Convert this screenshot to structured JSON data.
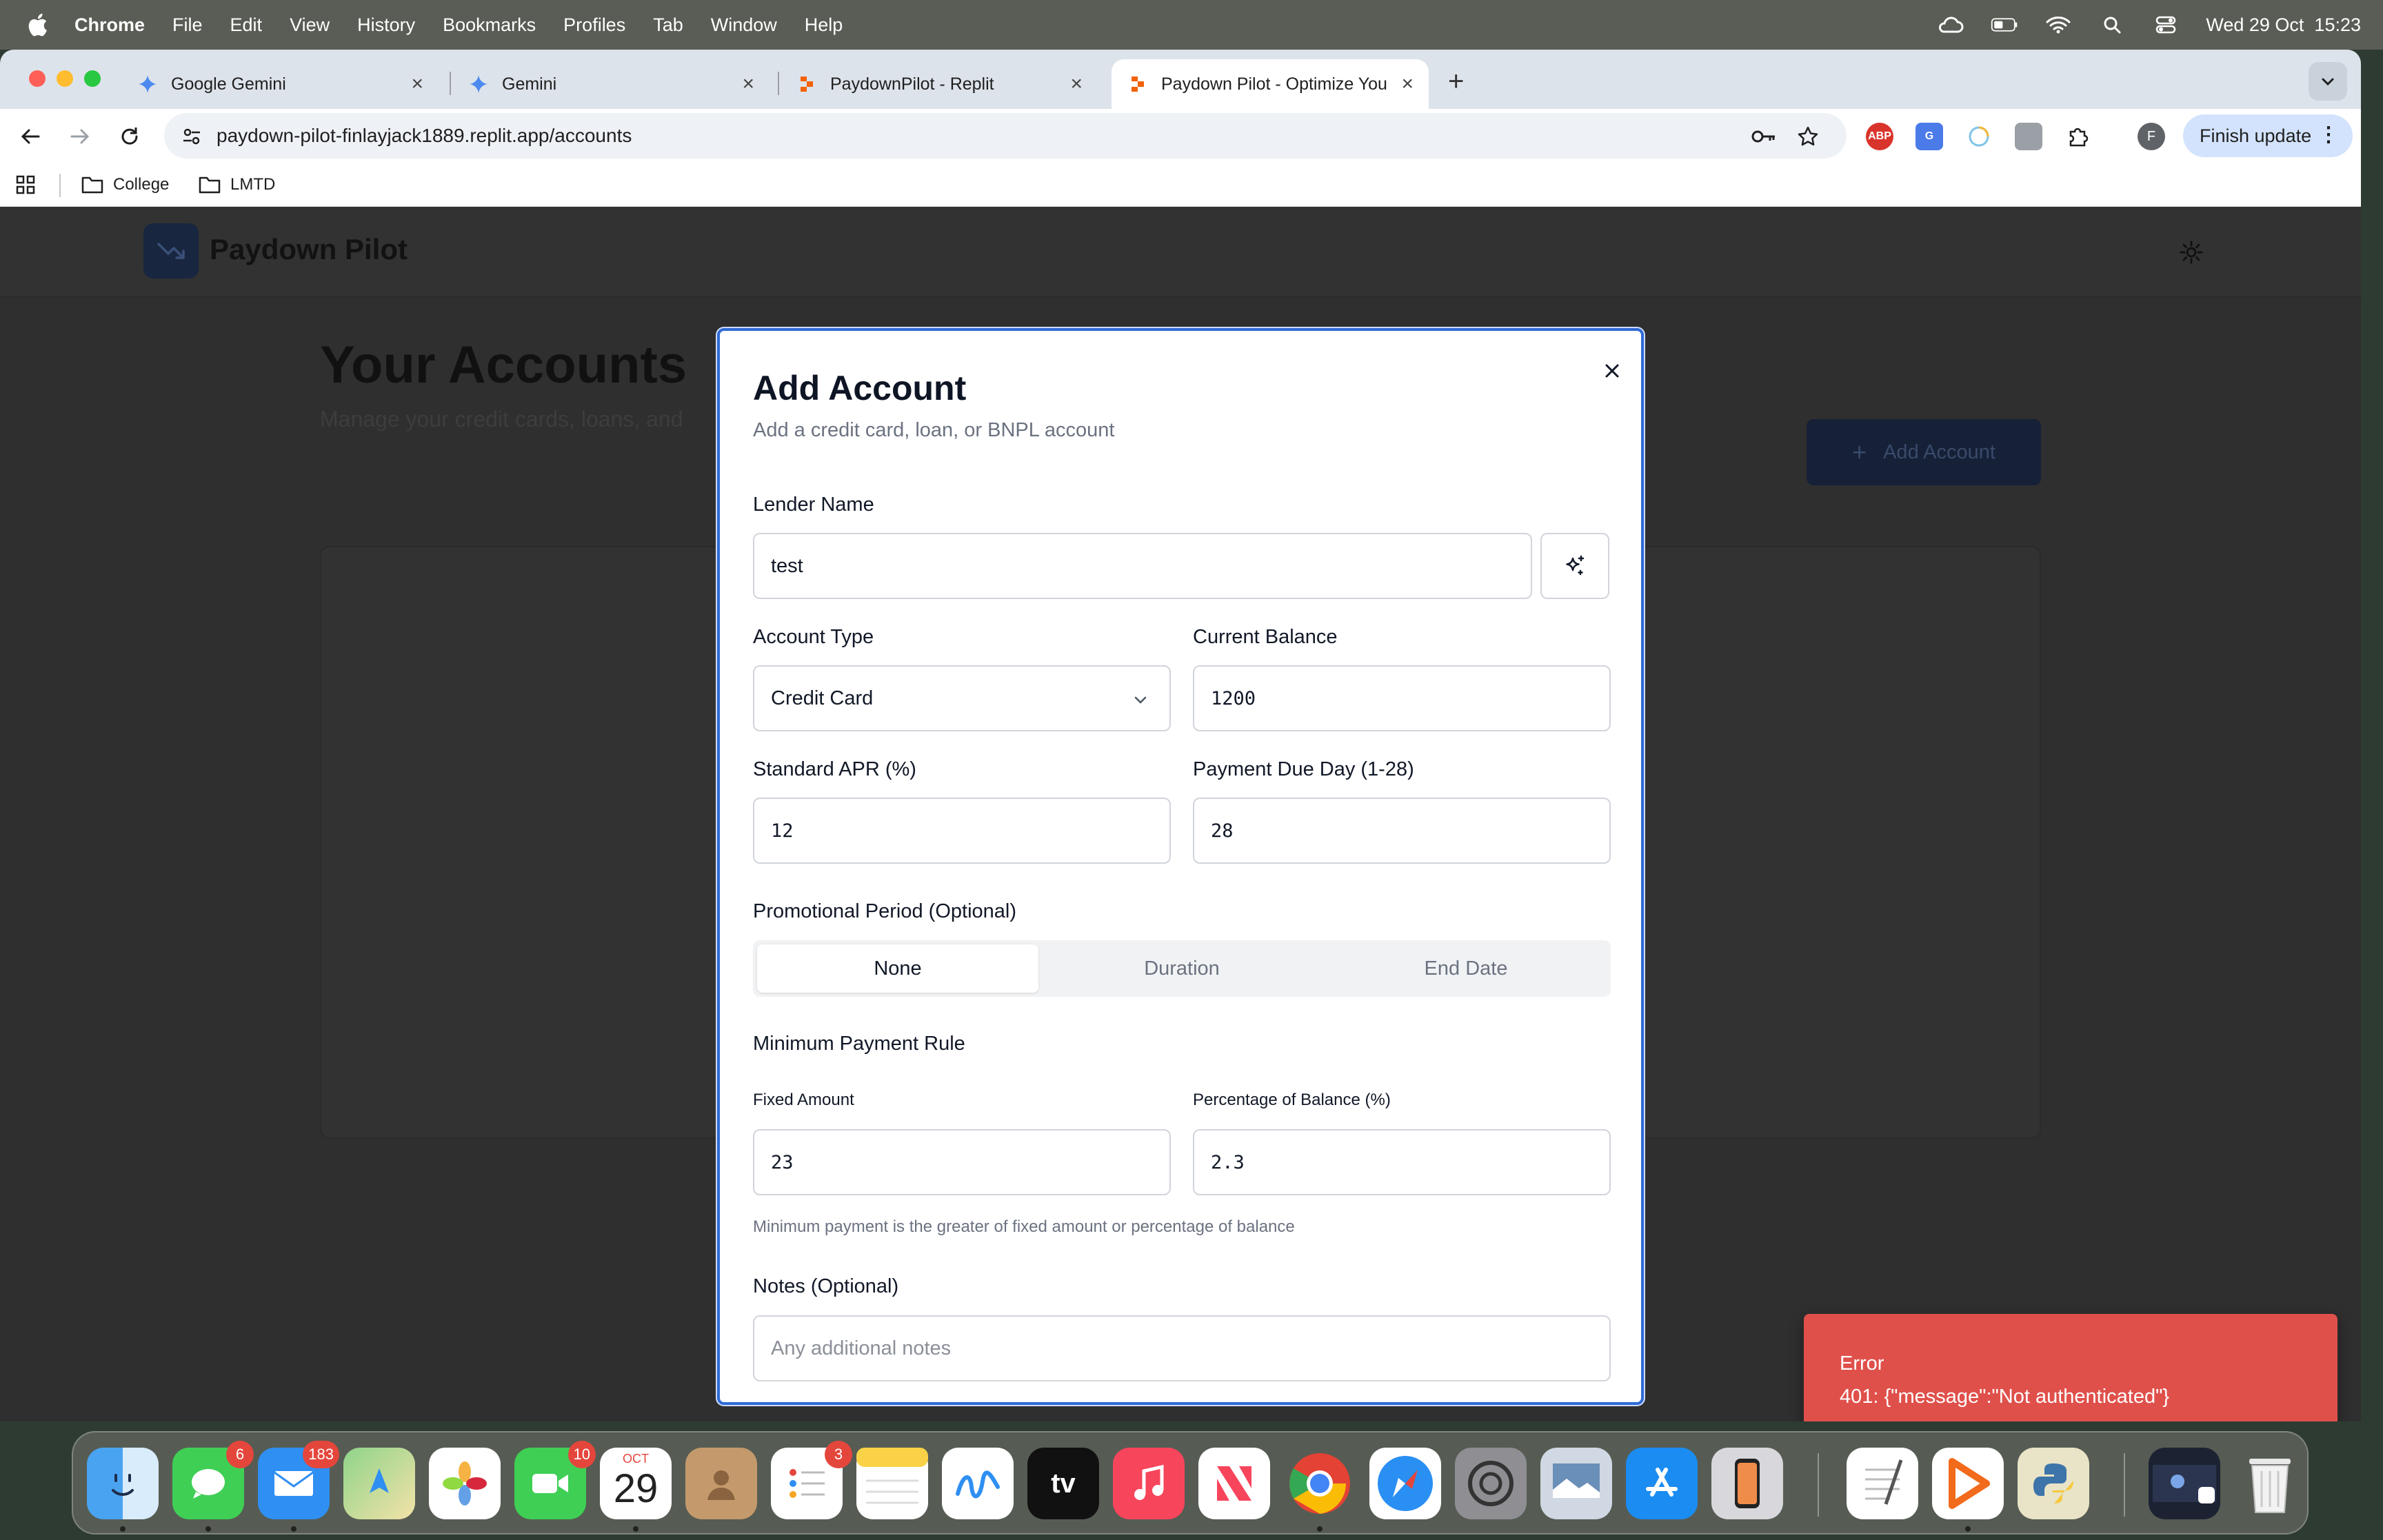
{
  "menubar": {
    "app_name": "Chrome",
    "items": [
      "File",
      "Edit",
      "View",
      "History",
      "Bookmarks",
      "Profiles",
      "Tab",
      "Window",
      "Help"
    ],
    "clock": "Wed 29 Oct  15:23"
  },
  "browser": {
    "tabs": [
      {
        "title": "Google Gemini",
        "icon": "gemini-icon"
      },
      {
        "title": "Gemini",
        "icon": "gemini-icon"
      },
      {
        "title": "PaydownPilot - Replit",
        "icon": "replit-icon"
      },
      {
        "title": "Paydown Pilot - Optimize You",
        "icon": "replit-icon",
        "active": true
      }
    ],
    "url": "paydown-pilot-finlayjack1889.replit.app/accounts",
    "profile_initial": "F",
    "finish_update_label": "Finish update",
    "bookmarks": [
      "College",
      "LMTD"
    ],
    "extensions": [
      "ABP"
    ]
  },
  "page": {
    "app_title": "Paydown Pilot",
    "heading": "Your Accounts",
    "subheading": "Manage your credit cards, loans, and",
    "add_account_button": "Add Account"
  },
  "modal": {
    "title": "Add Account",
    "description": "Add a credit card, loan, or BNPL account",
    "lender_name": {
      "label": "Lender Name",
      "value": "test"
    },
    "account_type": {
      "label": "Account Type",
      "value": "Credit Card"
    },
    "current_balance": {
      "label": "Current Balance",
      "value": "1200"
    },
    "standard_apr": {
      "label": "Standard APR (%)",
      "value": "12"
    },
    "payment_due_day": {
      "label": "Payment Due Day (1-28)",
      "value": "28"
    },
    "promotional_period": {
      "label": "Promotional Period (Optional)",
      "options": [
        "None",
        "Duration",
        "End Date"
      ],
      "selected": "None"
    },
    "minimum_payment": {
      "label": "Minimum Payment Rule",
      "fixed_amount_label": "Fixed Amount",
      "fixed_amount_value": "23",
      "percentage_label": "Percentage of Balance (%)",
      "percentage_value": "2.3",
      "hint": "Minimum payment is the greater of fixed amount or percentage of balance"
    },
    "notes": {
      "label": "Notes (Optional)",
      "placeholder": "Any additional notes"
    }
  },
  "toast": {
    "title": "Error",
    "message": "401: {\"message\":\"Not authenticated\"}",
    "color": "#e0504b"
  },
  "dock": {
    "badges": {
      "messages": "6",
      "mail": "183",
      "facetime": "10",
      "reminders": "3"
    },
    "calendar": {
      "month": "OCT",
      "day": "29"
    },
    "tv_label": "tv"
  },
  "colors": {
    "accent": "#2f6bd6",
    "error": "#e0504b",
    "logo_bg": "#182640"
  }
}
